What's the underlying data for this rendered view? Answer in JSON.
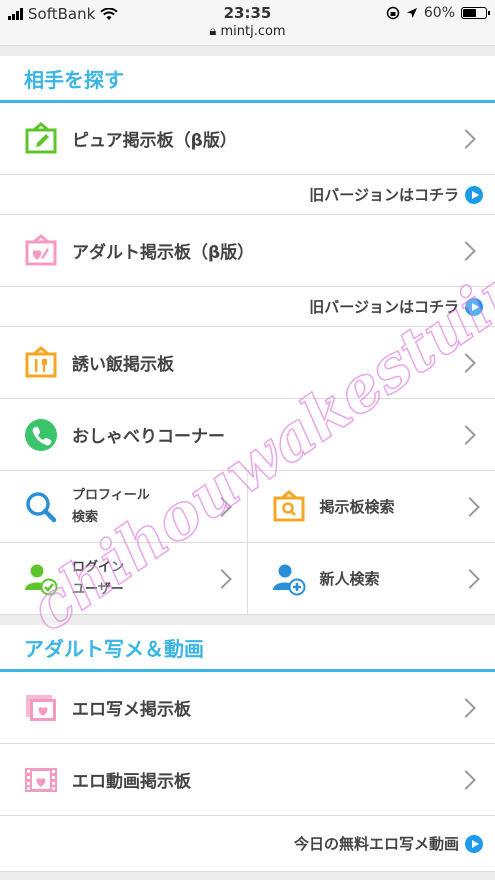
{
  "status": {
    "carrier": "SoftBank",
    "time": "23:35",
    "url": "mintj.com",
    "battery": "60%",
    "battery_level": 0.6
  },
  "section1": {
    "title": "相手を探す",
    "items": [
      {
        "label": "ピュア掲示板（β版）"
      },
      {
        "label": "アダルト掲示板（β版）"
      },
      {
        "label": "誘い飯掲示板"
      },
      {
        "label": "おしゃべりコーナー"
      }
    ],
    "old_version_label": "旧バージョンはコチラ",
    "grid": [
      {
        "line1": "プロフィール",
        "line2": "検索"
      },
      {
        "label": "掲示板検索"
      },
      {
        "line1": "ログイン",
        "line2": "ユーザー"
      },
      {
        "label": "新人検索"
      }
    ]
  },
  "section2": {
    "title": "アダルト写メ＆動画",
    "items": [
      {
        "label": "エロ写メ掲示板"
      },
      {
        "label": "エロ動画掲示板"
      }
    ],
    "today_link": "今日の無料エロ写メ動画"
  },
  "watermark": "chihouwakestuireeet.net",
  "colors": {
    "accent": "#3bb4e6",
    "pure_green": "#5ec42c",
    "adult_pink": "#f59ac0",
    "meal_orange": "#f5a623",
    "chat_green": "#3cc46b",
    "link_blue": "#1d9ae8"
  }
}
